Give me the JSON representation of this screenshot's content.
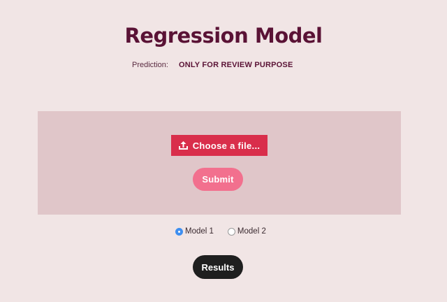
{
  "header": {
    "title": "Regression Model",
    "prediction_label": "Prediction:",
    "prediction_value": "ONLY FOR REVIEW PURPOSE"
  },
  "upload": {
    "choose_file_label": "Choose a file...",
    "choose_file_icon": "upload-icon",
    "submit_label": "Submit"
  },
  "models": {
    "options": [
      {
        "label": "Model 1",
        "selected": true
      },
      {
        "label": "Model 2",
        "selected": false
      }
    ]
  },
  "results_label": "Results",
  "colors": {
    "background": "#f1e5e5",
    "title": "#5a1235",
    "panel": "#e0c6c9",
    "choose_file": "#d92e4b",
    "submit": "#f2708e",
    "radio_selected": "#3f8ff0",
    "results": "#1f1f1f"
  }
}
